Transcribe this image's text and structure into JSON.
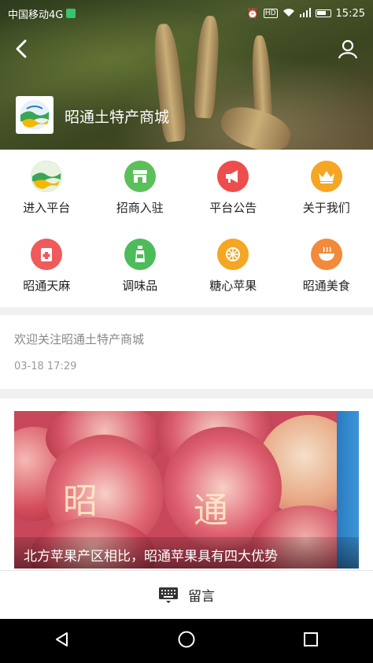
{
  "status_bar": {
    "carrier": "中国移动4G",
    "time": "15:25",
    "icons": [
      "alarm-icon",
      "hd-icon",
      "wifi-icon",
      "signal-icon",
      "battery-icon"
    ]
  },
  "header": {
    "shop_name": "昭通土特产商城",
    "back_icon": "chevron-left-icon",
    "user_icon": "user-icon"
  },
  "menu": [
    {
      "label": "进入平台",
      "icon": "landscape-icon",
      "color": "#3aa556"
    },
    {
      "label": "招商入驻",
      "icon": "storefront-icon",
      "color": "#5cc05a"
    },
    {
      "label": "平台公告",
      "icon": "megaphone-icon",
      "color": "#ee4d4d"
    },
    {
      "label": "关于我们",
      "icon": "crown-icon",
      "color": "#f5a623"
    },
    {
      "label": "昭通天麻",
      "icon": "medicine-icon",
      "color": "#ef5a5a"
    },
    {
      "label": "调味品",
      "icon": "bottle-icon",
      "color": "#4cbc5a"
    },
    {
      "label": "糖心苹果",
      "icon": "citrus-icon",
      "color": "#f5a623"
    },
    {
      "label": "昭通美食",
      "icon": "bowl-icon",
      "color": "#f28a3a"
    }
  ],
  "notice": {
    "text": "欢迎关注昭通土特产商城",
    "time": "03-18 17:29"
  },
  "article": {
    "caption": "北方苹果产区相比，昭通苹果具有四大优势",
    "apple_chars": [
      "昭",
      "通"
    ]
  },
  "bottom_bar": {
    "label": "留言",
    "icon": "keyboard-icon"
  },
  "nav": {
    "icons": [
      "back-triangle-icon",
      "home-circle-icon",
      "recents-square-icon"
    ]
  }
}
